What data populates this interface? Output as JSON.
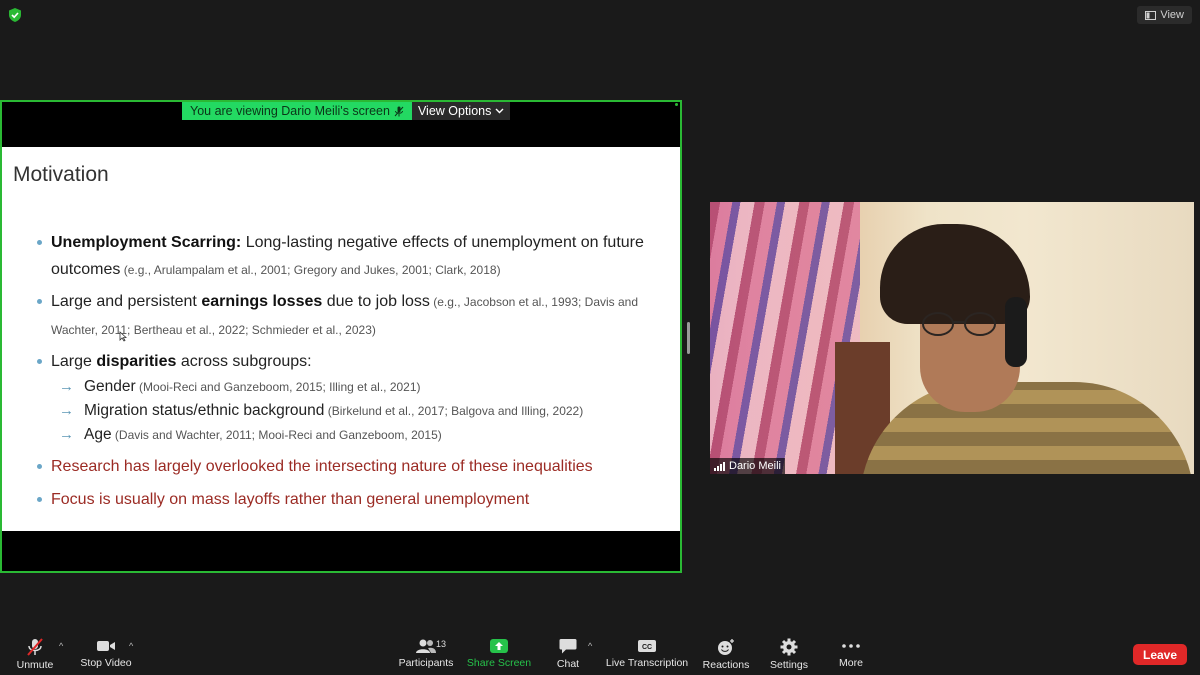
{
  "top_bar": {
    "view_label": "View"
  },
  "share_banner": {
    "viewing_text": "You are viewing Dario Meili's screen",
    "view_options_label": "View Options"
  },
  "slide": {
    "title": "Motivation",
    "bullets": [
      {
        "bold": "Unemployment Scarring:",
        "text": " Long-lasting negative effects of unemployment on future outcomes",
        "cite": " (e.g., Arulampalam et al., 2001; Gregory and Jukes, 2001; Clark, 2018)"
      },
      {
        "pre": "Large and persistent ",
        "bold": "earnings losses",
        "text": " due to job loss",
        "cite": " (e.g., Jacobson et al., 1993; Davis and Wachter, 2011; Bertheau et al., 2022; Schmieder et al., 2023)"
      },
      {
        "pre": "Large ",
        "bold": "disparities",
        "text": " across subgroups:"
      }
    ],
    "subitems": [
      {
        "text": "Gender",
        "cite": " (Mooi-Reci and Ganzeboom, 2015; Illing et al., 2021)"
      },
      {
        "text": "Migration status/ethnic background",
        "cite": " (Birkelund et al., 2017; Balgova and Illing, 2022)"
      },
      {
        "text": "Age",
        "cite": " (Davis and Wachter, 2011; Mooi-Reci and Ganzeboom, 2015)"
      }
    ],
    "red_bullets": [
      "Research has largely overlooked the intersecting nature of these inequalities",
      "Focus is usually on mass layoffs rather than general unemployment"
    ]
  },
  "video": {
    "participant_name": "Dario Meili"
  },
  "toolbar": {
    "unmute": "Unmute",
    "stop_video": "Stop Video",
    "participants": "Participants",
    "participants_count": "13",
    "share_screen": "Share Screen",
    "chat": "Chat",
    "live_transcription": "Live Transcription",
    "cc": "CC",
    "reactions": "Reactions",
    "settings": "Settings",
    "more": "More",
    "leave": "Leave"
  },
  "colors": {
    "share_green": "#2ab934",
    "banner_green": "#23d962",
    "leave_red": "#e02828",
    "slide_red": "#9b2b24"
  }
}
